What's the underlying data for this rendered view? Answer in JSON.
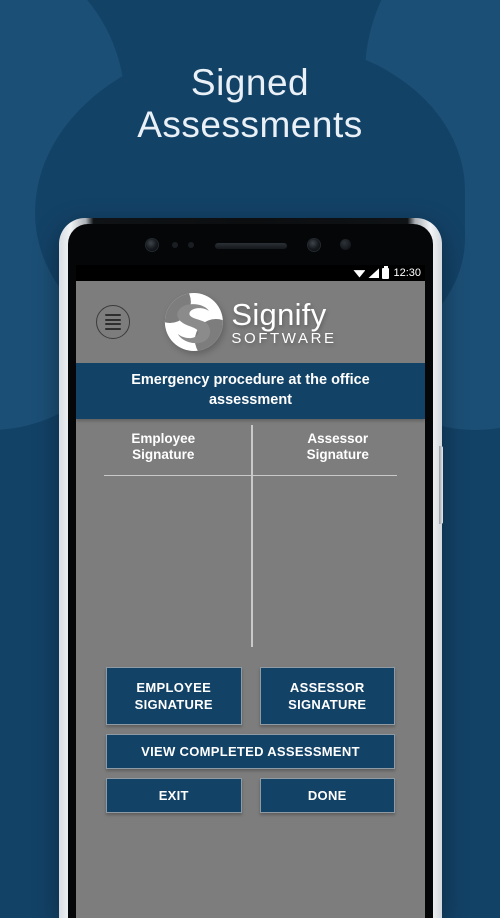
{
  "hero": {
    "line1": "Signed",
    "line2": "Assessments"
  },
  "colors": {
    "background": "#134267",
    "background_blob": "#1c4f76",
    "app_background": "#7d7d7d",
    "accent_blue": "#134267",
    "text_light": "#ffffff"
  },
  "phone": {
    "status_bar": {
      "time": "12:30",
      "icons": [
        "wifi-icon",
        "signal-icon",
        "battery-icon"
      ]
    }
  },
  "app": {
    "menu_button": "menu-icon",
    "brand": {
      "name": "Signify",
      "tagline": "SOFTWARE",
      "logo": "signify-s-logo"
    },
    "title": "Emergency procedure at the office assessment",
    "signature_columns": [
      {
        "line1": "Employee",
        "line2": "Signature"
      },
      {
        "line1": "Assessor",
        "line2": "Signature"
      }
    ],
    "buttons": {
      "employee_signature_l1": "EMPLOYEE",
      "employee_signature_l2": "SIGNATURE",
      "assessor_signature_l1": "ASSESSOR",
      "assessor_signature_l2": "SIGNATURE",
      "view_completed": "VIEW COMPLETED ASSESSMENT",
      "exit": "EXIT",
      "done": "DONE"
    }
  }
}
